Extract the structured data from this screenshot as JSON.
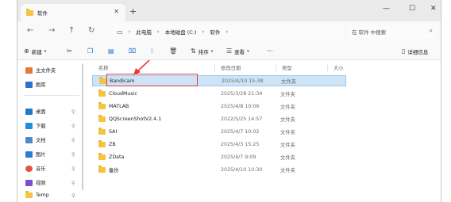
{
  "tab": {
    "title": "软件",
    "close": "✕",
    "new": "+"
  },
  "window_controls": {
    "minimize": "—",
    "maximize": "☐",
    "close": "✕"
  },
  "nav": {
    "back": "←",
    "forward": "→",
    "up": "↑",
    "refresh": "↻",
    "breadcrumbs": [
      "此电脑",
      "本地磁盘 (C:)",
      "软件"
    ],
    "search_placeholder": "在 软件 中搜索"
  },
  "toolbar": {
    "new_label": "新建",
    "sort_label": "排序",
    "view_label": "查看",
    "more_label": "···",
    "details_label": "详细信息"
  },
  "sidebar": {
    "items": [
      {
        "label": "主文件夹",
        "color": "#e07b39",
        "pinned": false
      },
      {
        "label": "图库",
        "color": "#2f6fd1",
        "pinned": false
      },
      {
        "label": "桌面",
        "color": "#1f78c8",
        "pinned": true
      },
      {
        "label": "下载",
        "color": "#1f8fd6",
        "pinned": true
      },
      {
        "label": "文档",
        "color": "#4f87c7",
        "pinned": true
      },
      {
        "label": "图片",
        "color": "#2c7ad8",
        "pinned": true
      },
      {
        "label": "音乐",
        "color": "#e2543a",
        "pinned": true
      },
      {
        "label": "视频",
        "color": "#7b4fd0",
        "pinned": true
      },
      {
        "label": "Temp",
        "color": "#f5c443",
        "pinned": true
      }
    ]
  },
  "columns": {
    "name": "名称",
    "date": "修改日期",
    "type": "类型",
    "size": "大小"
  },
  "files": [
    {
      "name": "Bandicam",
      "date": "2025/4/10 15:38",
      "type": "文件夹",
      "selected": true
    },
    {
      "name": "CloudMusic",
      "date": "2025/3/28 21:34",
      "type": "文件夹",
      "selected": false
    },
    {
      "name": "MATLAB",
      "date": "2025/4/8 10:06",
      "type": "文件夹",
      "selected": false
    },
    {
      "name": "QQScreenShotV2.4.1",
      "date": "2022/5/25 14:57",
      "type": "文件夹",
      "selected": false
    },
    {
      "name": "SAI",
      "date": "2025/4/7 10:02",
      "type": "文件夹",
      "selected": false
    },
    {
      "name": "ZB",
      "date": "2025/4/3 15:25",
      "type": "文件夹",
      "selected": false
    },
    {
      "name": "ZData",
      "date": "2025/4/7 9:09",
      "type": "文件夹",
      "selected": false
    },
    {
      "name": "备份",
      "date": "2025/4/10 10:30",
      "type": "文件夹",
      "selected": false
    }
  ],
  "colors": {
    "selection": "#cde4f7",
    "annotation": "#e23b3b",
    "folder": "#f5c443"
  }
}
